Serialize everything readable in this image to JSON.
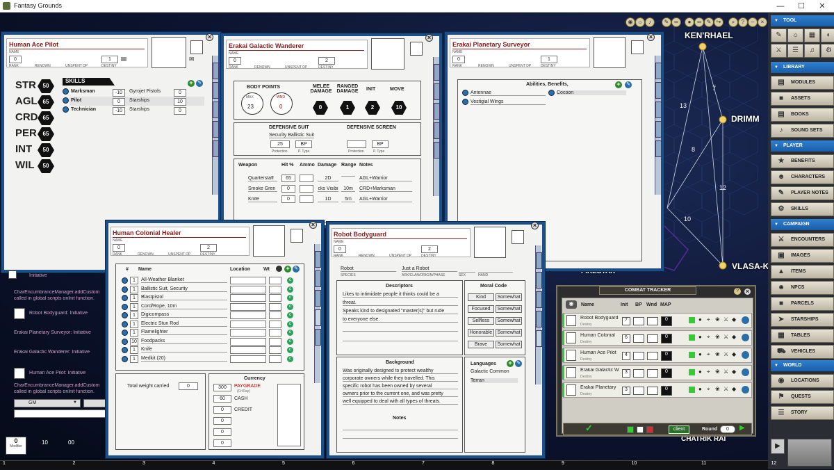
{
  "app": {
    "title": "Fantasy Grounds",
    "win_min": "—",
    "win_max": "☐",
    "win_close": "✕"
  },
  "colors": {
    "window_border": "#1c4f86",
    "title_red": "#8b1a1a",
    "sidebar_blue": "#1a5ea8",
    "hex_black": "#111111",
    "green": "#2aa35a"
  },
  "map": {
    "systems": [
      "KEN'RHAEL",
      "DRIMM",
      "VLASA-KAI",
      "FIRESTAR",
      "CHATRIK RAI"
    ],
    "edge_labels": [
      "7",
      "13",
      "8",
      "12",
      "10"
    ]
  },
  "sidebar": {
    "sections": [
      {
        "label": "TOOL",
        "items": []
      },
      {
        "label": "LIBRARY",
        "items": [
          "MODULES",
          "ASSETS",
          "BOOKS",
          "SOUND SETS"
        ]
      },
      {
        "label": "PLAYER",
        "items": [
          "BENEFITS",
          "CHARACTERS",
          "PLAYER NOTES",
          "SKILLS"
        ]
      },
      {
        "label": "CAMPAIGN",
        "items": [
          "ENCOUNTERS",
          "IMAGES",
          "ITEMS",
          "NPCS",
          "PARCELS",
          "STARSHIPS",
          "TABLES",
          "VEHICLES"
        ]
      },
      {
        "label": "WORLD",
        "items": [
          "LOCATIONS",
          "QUESTS",
          "STORY"
        ]
      }
    ]
  },
  "labels": {
    "name": "NAME",
    "rank": "RANK",
    "renown": "RENOWN",
    "unspent_dp": "UNSPENT DP",
    "destiny": "DESTINY"
  },
  "pilot": {
    "title": "Human Ace Pilot",
    "rank": "0",
    "destiny": "1",
    "stats": [
      {
        "k": "STR",
        "v": "50"
      },
      {
        "k": "AGL",
        "v": "65"
      },
      {
        "k": "CRD",
        "v": "65"
      },
      {
        "k": "PER",
        "v": "65"
      },
      {
        "k": "INT",
        "v": "50"
      },
      {
        "k": "WIL",
        "v": "50"
      }
    ],
    "skills_title": "SKILLS",
    "skills": [
      {
        "n": "Marksman",
        "v": "-10",
        "n2": "Gyrojet Pistols",
        "v2": "0"
      },
      {
        "n": "Pilot",
        "v": "0",
        "n2": "Starships",
        "v2": "10"
      },
      {
        "n": "Technician",
        "v": "-10",
        "n2": "Starships",
        "v2": "0"
      }
    ]
  },
  "wanderer": {
    "title": "Erakai Galactic Wanderer",
    "rank": "0",
    "destiny": "2",
    "body_points": "BODY POINTS",
    "max_lbl": "MAX",
    "max": "23",
    "wnd_lbl": "WND",
    "wnd": "0",
    "melee": "MELEE DAMAGE",
    "ranged": "RANGED DAMAGE",
    "init": "INIT",
    "move": "MOVE",
    "melee_v": "0",
    "ranged_v": "1",
    "init_v": "2",
    "move_v": "10",
    "def_suit": "DEFENSIVE SUIT",
    "def_screen": "DEFENSIVE SCREEN",
    "suit_name": "Security Ballistic Suit",
    "suit_prot": "25",
    "suit_type": "BP",
    "screen_type": "BP",
    "protection": "Protection",
    "ptype": "P. Type",
    "w_headers": [
      "Weapon",
      "Hit %",
      "Ammo",
      "Damage",
      "Range",
      "Notes"
    ],
    "weapons": [
      {
        "n": "Quarterstaff",
        "h": "65",
        "a": "",
        "d": "2D",
        "r": "",
        "no": "AGL+Warrior"
      },
      {
        "n": "Smoke Gren",
        "h": "0",
        "a": "",
        "d": "cks Visibi",
        "r": "10m",
        "no": "CRD+Marksman"
      },
      {
        "n": "Knife",
        "h": "0",
        "a": "",
        "d": "1D",
        "r": "5m",
        "no": "AGL+Warrior"
      }
    ]
  },
  "surveyor": {
    "title": "Erakai Planetary Surveyor",
    "rank": "0",
    "destiny": "1",
    "abilities": "Abilities, Benefits,",
    "items": [
      "Antennae",
      "Cocoon",
      "Vestigial Wings"
    ]
  },
  "healer": {
    "title": "Human Colonial Healer",
    "rank": "0",
    "destiny": "2",
    "hdr_num": "#",
    "hdr_name": "Name",
    "hdr_loc": "Location",
    "hdr_wt": "Wt",
    "items": [
      {
        "q": "1",
        "n": "All-Weather Blanket"
      },
      {
        "q": "1",
        "n": "Ballistic Suit, Security"
      },
      {
        "q": "1",
        "n": "Blastpistol"
      },
      {
        "q": "1",
        "n": "Cord/Rope, 10m"
      },
      {
        "q": "1",
        "n": "Digicompass"
      },
      {
        "q": "1",
        "n": "Electric Stun Rod"
      },
      {
        "q": "1",
        "n": "Flamelighter"
      },
      {
        "q": "10",
        "n": "Foodpacks"
      },
      {
        "q": "1",
        "n": "Knife"
      },
      {
        "q": "1",
        "n": "Medkit (20)"
      }
    ],
    "total_wt": "Total weight carried",
    "total_wt_v": "0",
    "currency": "Currency",
    "cur": [
      {
        "v": "300",
        "l": "PAYGRADE",
        "l2": "(Cr/Day)"
      },
      {
        "v": "60",
        "l": "CASH"
      },
      {
        "v": "0",
        "l": "CREDIT"
      },
      {
        "v": "0",
        "l": ""
      },
      {
        "v": "0",
        "l": ""
      },
      {
        "v": "0",
        "l": ""
      }
    ]
  },
  "robot": {
    "title": "Robot Bodyguard",
    "rank": "0",
    "destiny": "2",
    "species": "Robot",
    "ark": "Just a Robot",
    "species_lbl": "SPECIES",
    "ark_lbl": "ARK/CLAN/ORIGIN/PHASE",
    "sex_lbl": "SEX",
    "hand_lbl": "HAND",
    "descriptors": "Descriptors",
    "desc_lines": [
      "Likes to intimidate people it thinks could be a",
      "threat.",
      "Speaks kind to designated \"master(s)\" but rude",
      "to everyone else."
    ],
    "moral": "Moral Code",
    "moral_rows": [
      {
        "a": "Kind",
        "b": "Somewhat"
      },
      {
        "a": "Focused",
        "b": "Somewhat"
      },
      {
        "a": "Selfless",
        "b": "Somewhat"
      },
      {
        "a": "Honorable",
        "b": "Somewhat"
      },
      {
        "a": "Brave",
        "b": "Somewhat"
      }
    ],
    "background": "Background",
    "bg_lines": [
      "Was originally designed to protect wealthy",
      "corporate owners while they travelled. This",
      "specific robot has been owned by several",
      "owners prior to the current one, and was pretty",
      "well equipped to deal with all types of threats."
    ],
    "notes": "Notes",
    "languages": "Languages",
    "lang_list": [
      "Galactic Common",
      "Terran"
    ]
  },
  "chat": {
    "lines": [
      "Initiative",
      "CharEncumbranceManager.addCustom",
      "called in global scripts onInit function.",
      "Robot Bodyguard:  Initiative",
      "Erakai Planetary Surveyor:  Initiative",
      "Erakai Galactic Wanderer:  Initiative",
      "Human Ace Pilot:  Initiative",
      "CharEncumbranceManager.addCustom",
      "called in global scripts onInit function."
    ],
    "identity": "GM",
    "modifier_v": "0",
    "modifier_lbl": "Modifier",
    "dice": [
      "10",
      "00"
    ]
  },
  "combat": {
    "title": "COMBAT TRACKER",
    "h_name": "Name",
    "h_init": "Init",
    "h_bp": "BP",
    "h_wnd": "Wnd",
    "h_map": "MAP",
    "rows": [
      {
        "n": "Robot Bodyguard",
        "sub": "Destiny",
        "init": "7",
        "map": "0"
      },
      {
        "n": "Human Colonial",
        "sub": "Destiny",
        "init": "6",
        "map": "0"
      },
      {
        "n": "Human Ace Pilot",
        "sub": "Destiny",
        "init": "4",
        "map": "0"
      },
      {
        "n": "Erakai Galactic W",
        "sub": "Destiny",
        "init": "3",
        "map": "0"
      },
      {
        "n": "Erakai Planetary",
        "sub": "Destiny",
        "init": "3",
        "map": "0"
      }
    ],
    "client": "client",
    "round_lbl": "Round",
    "round": "0"
  },
  "ruler": [
    "1",
    "2",
    "3",
    "4",
    "5",
    "6",
    "7",
    "8",
    "9",
    "10",
    "11",
    "12"
  ]
}
